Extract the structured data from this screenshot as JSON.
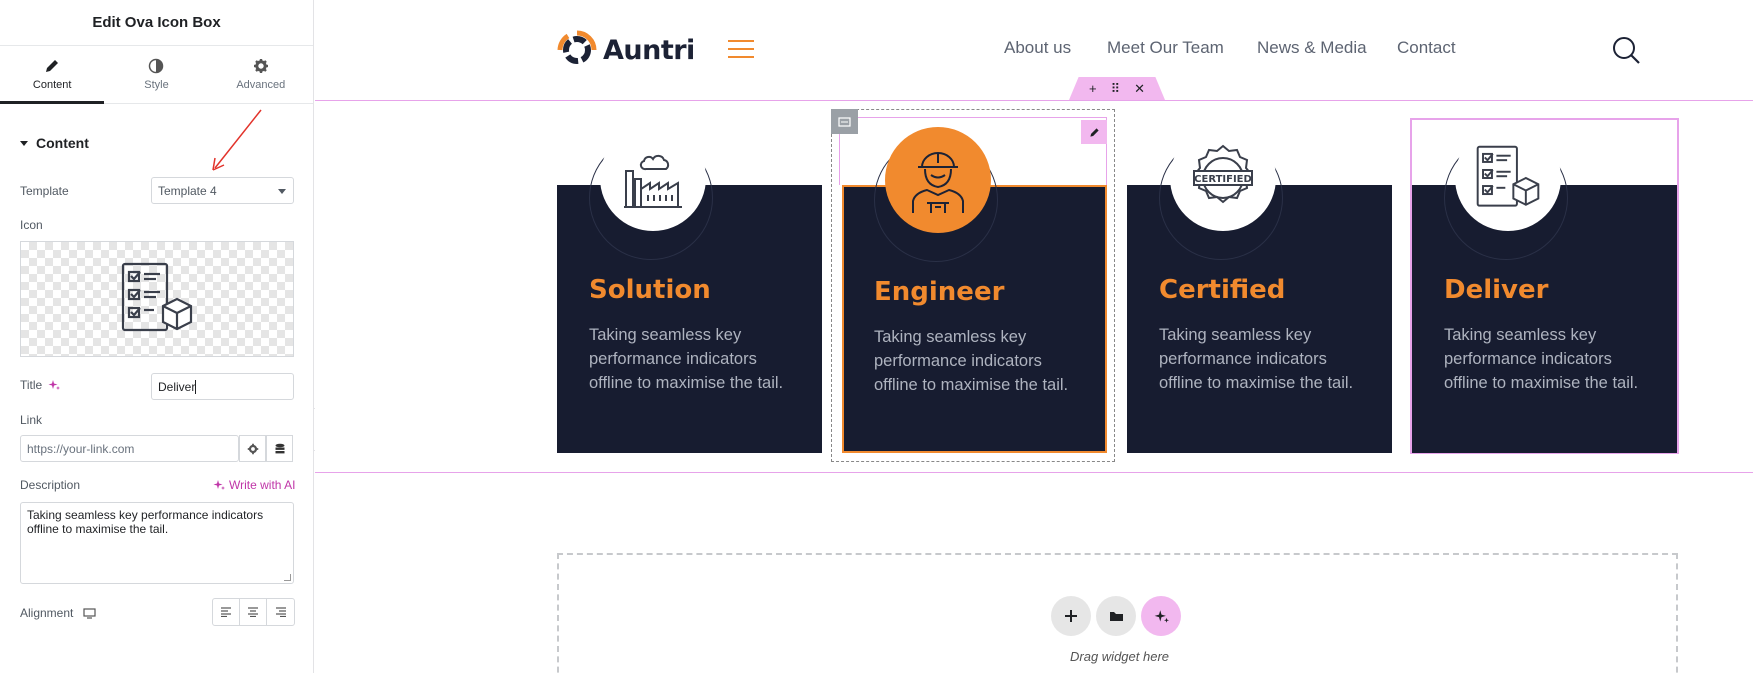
{
  "panel": {
    "title": "Edit Ova Icon Box",
    "tabs": [
      {
        "label": "Content",
        "icon": "pencil-icon"
      },
      {
        "label": "Style",
        "icon": "contrast-icon"
      },
      {
        "label": "Advanced",
        "icon": "gear-icon"
      }
    ],
    "section": "Content",
    "template_label": "Template",
    "template_value": "Template 4",
    "icon_label": "Icon",
    "title_label": "Title",
    "title_value": "Deliver",
    "link_label": "Link",
    "link_placeholder": "https://your-link.com",
    "description_label": "Description",
    "write_ai": "Write with AI",
    "description_value": "Taking seamless key performance indicators offline to maximise the tail.",
    "alignment_label": "Alignment"
  },
  "site": {
    "logo": "Auntri",
    "nav": [
      "About us",
      "Meet Our Team",
      "News & Media",
      "Contact"
    ],
    "brand_color": "#f18a2e",
    "card_bg": "#171c30"
  },
  "cards": [
    {
      "title": "Solution",
      "desc": "Taking seamless key performance indicators offline to maximise the tail.",
      "icon": "factory-icon"
    },
    {
      "title": "Engineer",
      "desc": "Taking seamless key performance indicators offline to maximise the tail.",
      "icon": "engineer-icon"
    },
    {
      "title": "Certified",
      "desc": "Taking seamless key performance indicators offline to maximise the tail.",
      "icon": "certified-badge-icon"
    },
    {
      "title": "Deliver",
      "desc": "Taking seamless key performance indicators offline to maximise the tail.",
      "icon": "checklist-box-icon"
    }
  ],
  "dropzone": {
    "label": "Drag widget here"
  }
}
